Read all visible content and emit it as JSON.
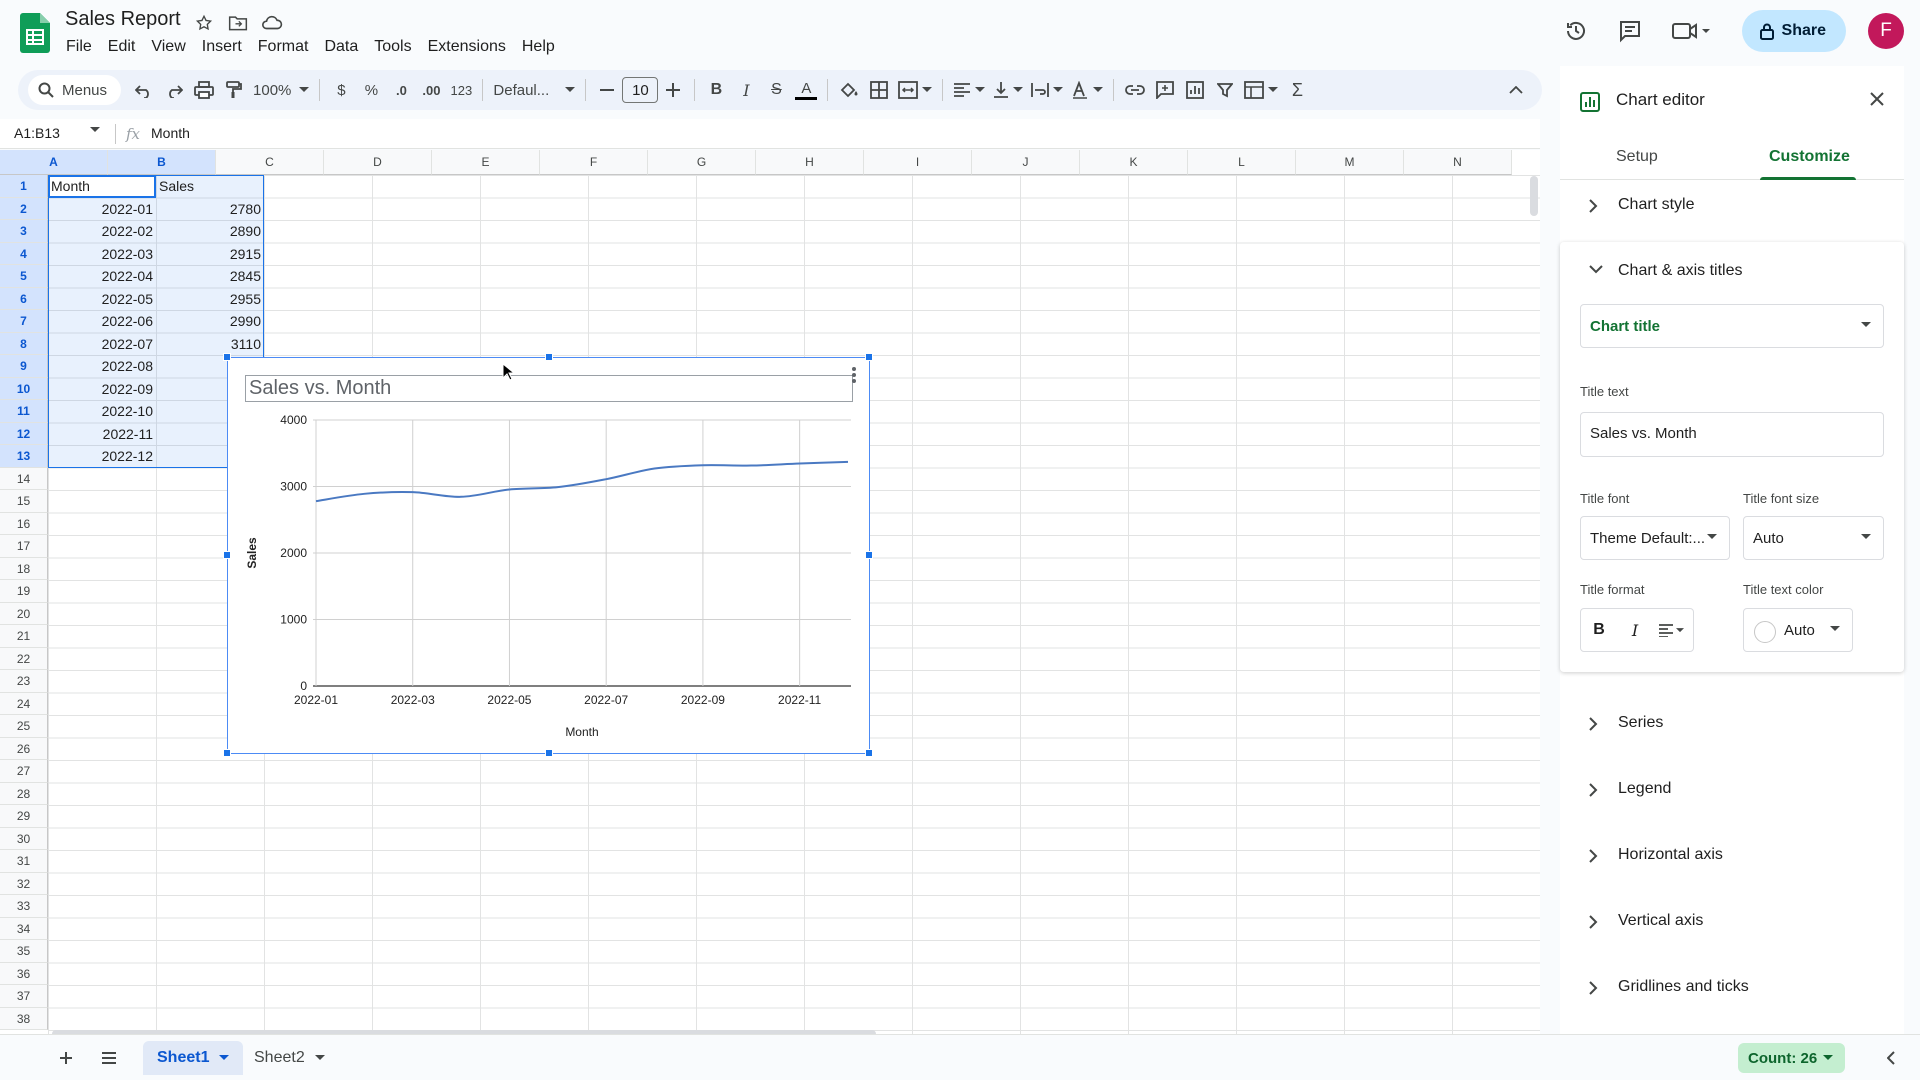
{
  "app": {
    "doc_title": "Sales Report",
    "menu": [
      "File",
      "Edit",
      "View",
      "Insert",
      "Format",
      "Data",
      "Tools",
      "Extensions",
      "Help"
    ],
    "share_label": "Share",
    "avatar_letter": "F"
  },
  "toolbar": {
    "menus_label": "Menus",
    "zoom": "100%",
    "currency": "$",
    "percent": "%",
    "dec_decrease": ".0",
    "dec_increase": ".00",
    "number_format": "123",
    "font": "Defaul...",
    "font_size": "10",
    "bold": "B",
    "italic": "I",
    "strike": "S",
    "text_color": "A",
    "sum": "Σ"
  },
  "formula_bar": {
    "name_box": "A1:B13",
    "fx": "fx",
    "value": "Month"
  },
  "grid": {
    "columns": [
      "A",
      "B",
      "C",
      "D",
      "E",
      "F",
      "G",
      "H",
      "I",
      "J",
      "K",
      "L",
      "M",
      "N"
    ],
    "row_count": 38,
    "header": [
      "Month",
      "Sales"
    ],
    "rows": [
      [
        "2022-01",
        "2780"
      ],
      [
        "2022-02",
        "2890"
      ],
      [
        "2022-03",
        "2915"
      ],
      [
        "2022-04",
        "2845"
      ],
      [
        "2022-05",
        "2955"
      ],
      [
        "2022-06",
        "2990"
      ],
      [
        "2022-07",
        "3110"
      ],
      [
        "2022-08",
        ""
      ],
      [
        "2022-09",
        ""
      ],
      [
        "2022-10",
        ""
      ],
      [
        "2022-11",
        ""
      ],
      [
        "2022-12",
        ""
      ]
    ]
  },
  "chart_data": {
    "type": "line",
    "title": "Sales vs. Month",
    "xlabel": "Month",
    "ylabel": "Sales",
    "categories": [
      "2022-01",
      "2022-02",
      "2022-03",
      "2022-04",
      "2022-05",
      "2022-06",
      "2022-07",
      "2022-08",
      "2022-09",
      "2022-10",
      "2022-11",
      "2022-12"
    ],
    "x_tick_labels": [
      "2022-01",
      "2022-03",
      "2022-05",
      "2022-07",
      "2022-09",
      "2022-11"
    ],
    "series": [
      {
        "values": [
          2780,
          2890,
          2915,
          2845,
          2955,
          2990,
          3110,
          3270,
          3320,
          3315,
          3345,
          3370
        ],
        "color": "#4a79c2"
      }
    ],
    "ylim": [
      0,
      4000
    ],
    "y_ticks": [
      0,
      1000,
      2000,
      3000,
      4000
    ],
    "grid": true
  },
  "panel": {
    "title": "Chart editor",
    "tabs": [
      "Setup",
      "Customize"
    ],
    "sections": {
      "chart_style": "Chart style",
      "chart_axis_titles": "Chart & axis titles",
      "series": "Series",
      "legend": "Legend",
      "horizontal_axis": "Horizontal axis",
      "vertical_axis": "Vertical axis",
      "gridlines": "Gridlines and ticks"
    },
    "title_type": "Chart title",
    "title_text_label": "Title text",
    "title_text_value": "Sales vs. Month",
    "title_font_label": "Title font",
    "title_font_value": "Theme Default:...",
    "title_font_size_label": "Title font size",
    "title_font_size_value": "Auto",
    "title_format_label": "Title format",
    "title_text_color_label": "Title text color",
    "title_text_color_value": "Auto",
    "format_bold": "B",
    "format_italic": "I"
  },
  "bottom": {
    "sheets": [
      "Sheet1",
      "Sheet2"
    ],
    "count": "Count: 26"
  },
  "colors": {
    "accent_green": "#137333",
    "selection_blue": "#1a73e8",
    "share_bg": "#c2e7ff",
    "count_bg": "#c4eed0",
    "avatar_bg": "#c2185b"
  }
}
